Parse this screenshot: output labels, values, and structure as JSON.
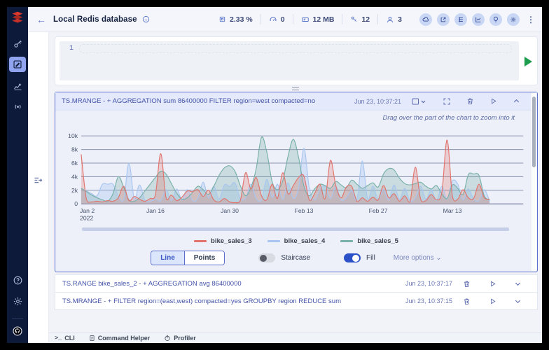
{
  "theme": {
    "accent": "#2b50c7",
    "sidebar_bg": "#0e1a3a",
    "sidebar_active": "#8fa3ee",
    "panel_border": "#5b70cc",
    "logo_red": "#dc382c",
    "run_green": "#1f9d4f"
  },
  "sidebar": {
    "items": [
      "browser",
      "workbench",
      "analytics",
      "pub-sub"
    ],
    "active": "workbench"
  },
  "header": {
    "title": "Local Redis database",
    "metrics": {
      "cpu": "2.33 %",
      "ops": "0",
      "memory": "12 MB",
      "keys": "12",
      "clients": "3"
    },
    "menu_dots": "⋮"
  },
  "editor": {
    "line_number": "1",
    "value": ""
  },
  "results": {
    "chart_panel": {
      "query": "TS.MRANGE - + AGGREGATION sum 86400000 FILTER region=west compacted=no",
      "timestamp": "Jun 23, 10:37:21",
      "hint": "Drag over the part of the chart to zoom into it"
    },
    "rows": [
      {
        "query": "TS.RANGE bike_sales_2 - + AGGREGATION avg 86400000",
        "timestamp": "Jun 23, 10:37:17"
      },
      {
        "query": "TS.MRANGE - + FILTER region=(east,west) compacted=yes GROUPBY region REDUCE sum",
        "timestamp": "Jun 23, 10:37:15"
      }
    ],
    "controls": {
      "line": "Line",
      "points": "Points",
      "staircase": "Staircase",
      "fill": "Fill",
      "more": "More options",
      "selected_mode": "Line",
      "staircase_on": false,
      "fill_on": true
    }
  },
  "bottom_bar": {
    "cli": "CLI",
    "command_helper": "Command Helper",
    "profiler": "Profiler"
  },
  "chart_data": {
    "type": "area",
    "x_start_date": "2022-01-02",
    "x_unit": "day",
    "x_tick_indices": [
      0,
      14,
      28,
      42,
      56,
      70
    ],
    "x_tick_labels": [
      "Jan 2\n2022",
      "Jan 16",
      "Jan 30",
      "Feb 13",
      "Feb 27",
      "Mar 13"
    ],
    "ylim": [
      0,
      10000
    ],
    "y_ticks": [
      0,
      2000,
      4000,
      6000,
      8000,
      10000
    ],
    "y_tick_labels": [
      "0",
      "2k",
      "4k",
      "6k",
      "8k",
      "10k"
    ],
    "grid": true,
    "legend_position": "bottom",
    "draw_order": [
      1,
      2,
      0
    ],
    "series": [
      {
        "name": "bike_sales_3",
        "color": "#e2736d",
        "fill": "rgba(226,115,109,0.28)",
        "values": [
          7300,
          600,
          300,
          400,
          300,
          500,
          400,
          900,
          2600,
          500,
          1100,
          700,
          400,
          800,
          1400,
          7400,
          900,
          1300,
          500,
          1000,
          1900,
          1800,
          2100,
          1100,
          2000,
          600,
          300,
          800,
          300,
          200,
          500,
          4600,
          2200,
          3900,
          1200,
          600,
          2900,
          800,
          4600,
          1500,
          2700,
          3900,
          4100,
          600,
          1500,
          2900,
          800,
          6400,
          2700,
          900,
          2500,
          2600,
          400,
          900,
          400,
          1000,
          600,
          2700,
          900,
          1500,
          400,
          1200,
          300,
          5400,
          700,
          500,
          1400,
          600,
          1700,
          9400,
          1100,
          700,
          2100,
          900,
          800,
          2900,
          900,
          700
        ]
      },
      {
        "name": "bike_sales_4",
        "color": "#a9c6f0",
        "fill": "rgba(169,198,240,0.38)",
        "values": [
          2300,
          1900,
          1500,
          1200,
          2900,
          2900,
          2900,
          1200,
          600,
          6000,
          800,
          2800,
          600,
          400,
          700,
          500,
          2100,
          500,
          2200,
          600,
          2100,
          500,
          800,
          3200,
          900,
          2600,
          700,
          2800,
          2600,
          3100,
          800,
          900,
          2900,
          800,
          600,
          3600,
          1000,
          2900,
          700,
          3100,
          800,
          2400,
          8200,
          2400,
          600,
          2100,
          2600,
          800,
          2500,
          600,
          900,
          2000,
          700,
          6300,
          800,
          2600,
          700,
          2100,
          600,
          2800,
          700,
          2300,
          500,
          900,
          2600,
          700,
          2100,
          500,
          2600,
          700,
          3400,
          2900,
          600,
          2200,
          700,
          500,
          2100,
          400
        ]
      },
      {
        "name": "bike_sales_5",
        "color": "#79b0a9",
        "fill": "rgba(121,176,169,0.30)",
        "values": [
          2300,
          1800,
          1300,
          900,
          600,
          400,
          1500,
          4000,
          2500,
          600,
          400,
          900,
          1900,
          2900,
          3900,
          4800,
          4400,
          3000,
          1600,
          700,
          900,
          1700,
          2600,
          2100,
          1400,
          2600,
          4200,
          5300,
          5600,
          4800,
          2700,
          1200,
          2400,
          5200,
          9800,
          7600,
          3300,
          2100,
          3400,
          7000,
          9500,
          6800,
          2600,
          1200,
          2200,
          2900,
          2700,
          2300,
          3300,
          2800,
          2400,
          3500,
          2900,
          2300,
          2700,
          3100,
          2500,
          4400,
          5200,
          5000,
          3800,
          3000,
          2800,
          3000,
          3200,
          2600,
          2200,
          2700,
          1500,
          800,
          2800,
          2300,
          1400,
          4300,
          4400,
          4200,
          1200,
          600
        ]
      }
    ]
  }
}
